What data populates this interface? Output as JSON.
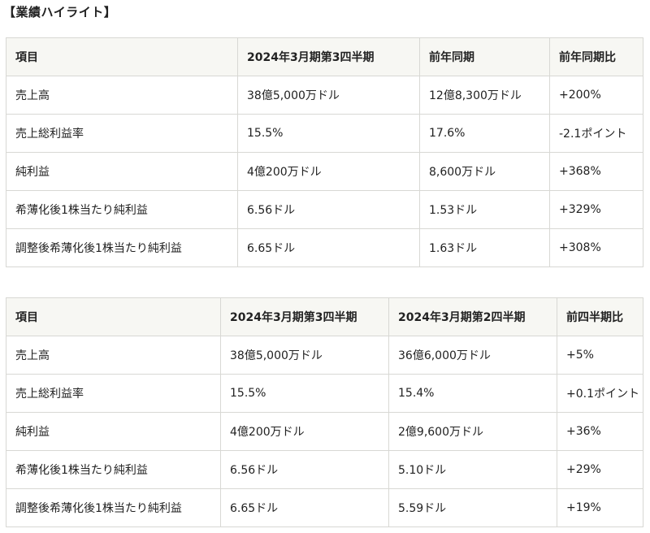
{
  "heading": "【業績ハイライト】",
  "table1": {
    "headers": [
      "項目",
      "2024年3月期第3四半期",
      "前年同期",
      "前年同期比"
    ],
    "rows": [
      [
        "売上高",
        "38億5,000万ドル",
        "12億8,300万ドル",
        "+200%"
      ],
      [
        "売上総利益率",
        "15.5%",
        "17.6%",
        "-2.1ポイント"
      ],
      [
        "純利益",
        "4億200万ドル",
        "8,600万ドル",
        "+368%"
      ],
      [
        "希薄化後1株当たり純利益",
        "6.56ドル",
        "1.53ドル",
        "+329%"
      ],
      [
        "調整後希薄化後1株当たり純利益",
        "6.65ドル",
        "1.63ドル",
        "+308%"
      ]
    ]
  },
  "table2": {
    "headers": [
      "項目",
      "2024年3月期第3四半期",
      "2024年3月期第2四半期",
      "前四半期比"
    ],
    "rows": [
      [
        "売上高",
        "38億5,000万ドル",
        "36億6,000万ドル",
        "+5%"
      ],
      [
        "売上総利益率",
        "15.5%",
        "15.4%",
        "+0.1ポイント"
      ],
      [
        "純利益",
        "4億200万ドル",
        "2億9,600万ドル",
        "+36%"
      ],
      [
        "希薄化後1株当たり純利益",
        "6.56ドル",
        "5.10ドル",
        "+29%"
      ],
      [
        "調整後希薄化後1株当たり純利益",
        "6.65ドル",
        "5.59ドル",
        "+19%"
      ]
    ]
  }
}
